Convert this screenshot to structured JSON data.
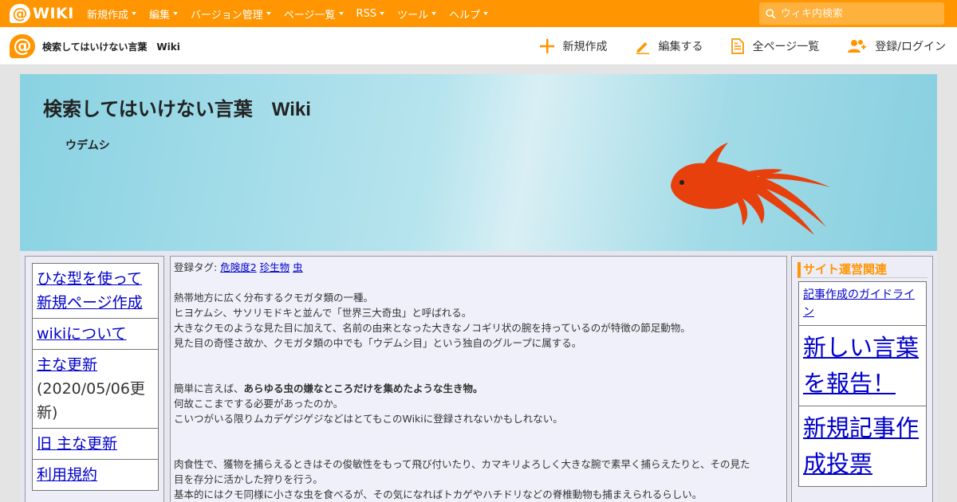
{
  "topbar": {
    "logo_text": "WIKI",
    "menu": [
      {
        "label": "新規作成"
      },
      {
        "label": "編集"
      },
      {
        "label": "バージョン管理"
      },
      {
        "label": "ページ一覧"
      },
      {
        "label": "RSS"
      },
      {
        "label": "ツール"
      },
      {
        "label": "ヘルプ"
      }
    ],
    "search_placeholder": "ウィキ内検索",
    "accent_color": "#ff9500"
  },
  "subbar": {
    "site_title": "検索してはいけない言葉　Wiki",
    "actions": [
      {
        "label": "新規作成",
        "icon": "plus-icon"
      },
      {
        "label": "編集する",
        "icon": "pencil-icon"
      },
      {
        "label": "全ページ一覧",
        "icon": "document-icon"
      },
      {
        "label": "登録/ログイン",
        "icon": "users-icon"
      }
    ]
  },
  "banner": {
    "title": "検索してはいけない言葉　Wiki",
    "page_name": "ウデムシ",
    "fish_color": "#e8400c"
  },
  "left_nav": {
    "items": [
      {
        "label": "ひな型を使って新規ページ作成"
      },
      {
        "label": "wikiについて"
      },
      {
        "label": "主な更新",
        "note": "(2020/05/06更新)"
      },
      {
        "label": "旧 主な更新"
      },
      {
        "label": "利用規約"
      }
    ]
  },
  "main": {
    "tags_label": "登録タグ:",
    "tags": [
      "危険度2",
      "珍生物",
      "虫"
    ],
    "para1": [
      "熱帯地方に広く分布するクモガタ類の一種。",
      "ヒヨケムシ、サソリモドキと並んで「世界三大奇虫」と呼ばれる。",
      "大きなクモのような見た目に加えて、名前の由来となった大きなノコギリ状の腕を持っているのが特徴の節足動物。",
      "見た目の奇怪さ故か、クモガタ類の中でも「ウデムシ目」という独自のグループに属する。"
    ],
    "para2_prefix": "簡単に言えば、",
    "para2_bold": "あらゆる虫の嫌なところだけを集めたような生き物。",
    "para2": [
      "何故ここまでする必要があったのか。",
      "こいつがいる限りムカデゲジゲジなどはとてもこのWikiに登録されないかもしれない。"
    ],
    "para3": [
      "肉食性で、獲物を捕らえるときはその俊敏性をもって飛び付いたり、カマキリよろしく大きな腕で素早く捕らえたりと、その見た",
      "目を存分に活かした狩りを行う。",
      "基本的にはクモ同様に小さな虫を食べるが、その気になればトカゲやハチドリなどの脊椎動物も捕まえられるらしい。"
    ]
  },
  "right_side": {
    "heading": "サイト運営関連",
    "items": [
      {
        "label": "記事作成のガイドライン",
        "size": "small"
      },
      {
        "label": "新しい言葉を報告！",
        "size": "big"
      },
      {
        "label": "新規記事作成投票",
        "size": "big"
      }
    ]
  }
}
